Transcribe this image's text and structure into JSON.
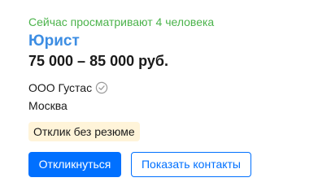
{
  "vacancy": {
    "viewers_text": "Сейчас просматривают 4 человека",
    "title": "Юрист",
    "salary": "75 000 – 85 000 руб.",
    "employer": "ООО Густас",
    "employer_verified_icon": "check-circle-icon",
    "city": "Москва",
    "badge": "Отклик без резюме"
  },
  "actions": {
    "respond_label": "Откликнуться",
    "show_contacts_label": "Показать контакты"
  },
  "colors": {
    "viewers": "#4bb34b",
    "title": "#3c8de3",
    "primary": "#0070ff",
    "badge_bg": "#fff4d9"
  }
}
